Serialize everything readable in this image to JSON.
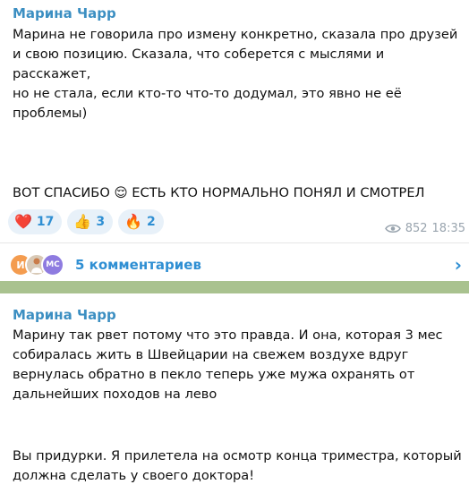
{
  "post1": {
    "author": "Марина Чарр",
    "text": "Марина не говорила про измену конкретно, сказала про друзей\nи свою позицию. Сказала, что соберется с мыслями и расскажет,\nно не стала, если кто-то что-то додумал, это явно не её\nпроблемы)",
    "text2": "ВОТ СПАСИБО 😌 ЕСТЬ КТО НОРМАЛЬНО ПОНЯЛ И СМОТРЕЛ",
    "reactions": [
      {
        "emoji": "❤️",
        "count": "17"
      },
      {
        "emoji": "👍",
        "count": "3"
      },
      {
        "emoji": "🔥",
        "count": "2"
      }
    ],
    "views": "852",
    "time": "18:35",
    "comments": {
      "avatars": [
        "И",
        "",
        "МС"
      ],
      "label": "5 комментариев"
    }
  },
  "post2": {
    "author": "Марина Чарр",
    "text": "Марину так рвет потому что это правда. И она, которая 3 мес\nсобиралась жить в Швейцарии на свежем воздухе вдруг\nвернулась обратно в пекло теперь уже мужа охранять от\nдальнейших походов на лево",
    "text2": "Вы придурки. Я прилетела на осмотр конца триместра, который\nдолжна сделать у своего доктора!"
  },
  "colors": {
    "accent": "#2f8fd3",
    "author": "#3c8fc2",
    "background": "#a9c28f"
  }
}
